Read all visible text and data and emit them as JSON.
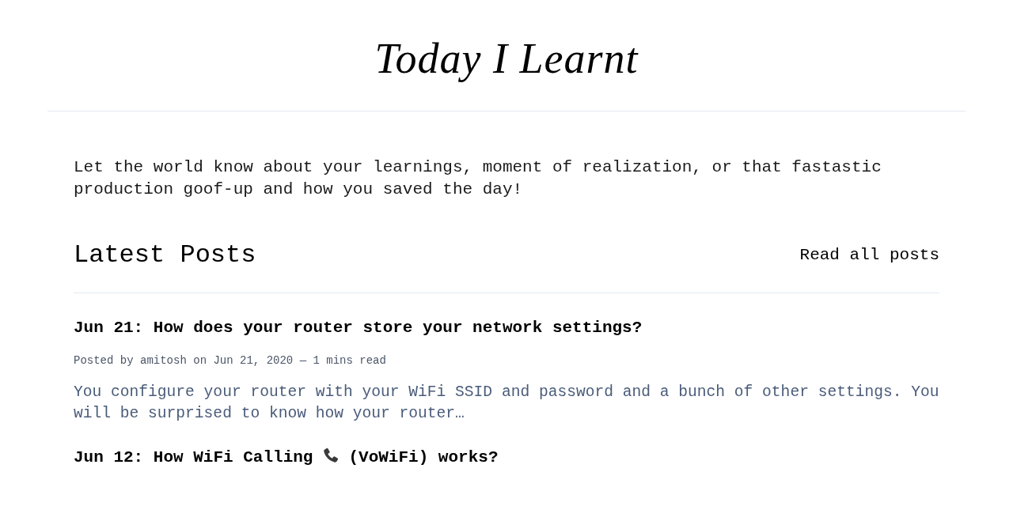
{
  "header": {
    "site_title": "Today I Learnt"
  },
  "intro": "Let the world know about your learnings, moment of realization, or that fastastic production goof-up and how you saved the day!",
  "latest": {
    "heading": "Latest Posts",
    "link": "Read all posts"
  },
  "posts": [
    {
      "title": [
        {
          "kind": "text",
          "text": "Jun 21: How does your router store your network settings?"
        }
      ],
      "meta": "Posted by amitosh on Jun 21, 2020 — 1 mins read",
      "excerpt": "You configure your router with your WiFi SSID and password and a bunch of other settings. You will be surprised to know how your router…"
    },
    {
      "title": [
        {
          "kind": "text",
          "text": "Jun 12: How WiFi Calling"
        },
        {
          "kind": "icon"
        },
        {
          "kind": "text",
          "text": "(VoWiFi) works?"
        }
      ]
    }
  ]
}
